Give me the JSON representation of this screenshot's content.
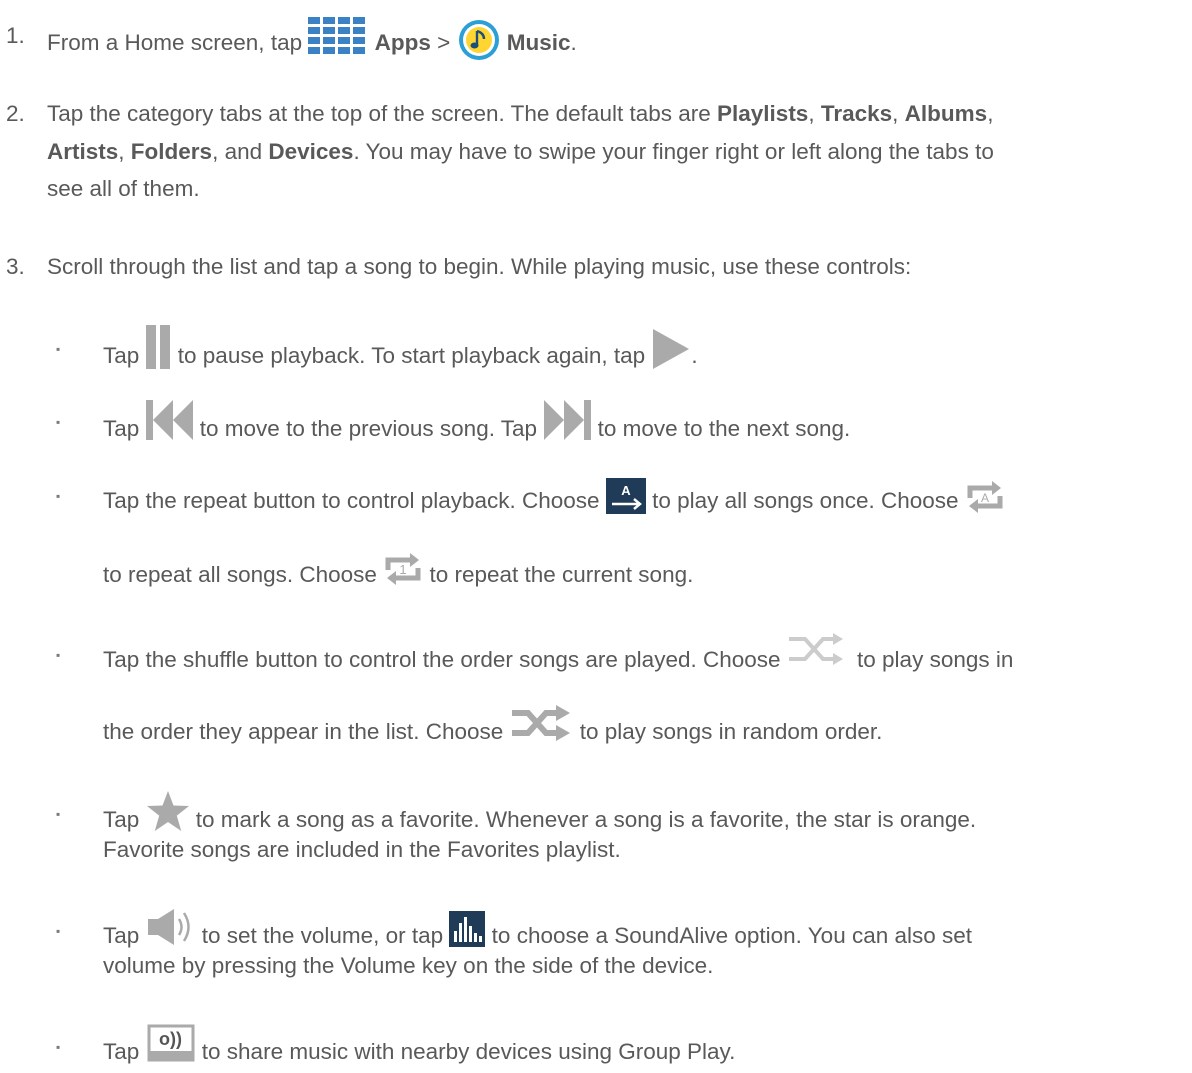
{
  "steps": [
    {
      "num": "1.",
      "prefix": "From a Home screen, tap ",
      "apps_label": "Apps",
      "sep": " > ",
      "music_label": "Music",
      "end": "."
    },
    {
      "num": "2.",
      "line1_a": "Tap the category tabs at the top of the screen. The default tabs are ",
      "playlists": "Playlists",
      "comma1": ", ",
      "tracks": "Tracks",
      "comma2": ", ",
      "albums": "Albums",
      "comma3": ",",
      "artists": "Artists",
      "comma4": ", ",
      "folders": "Folders",
      "and": ", and ",
      "devices": "Devices",
      "line2_end": ". You may have to swipe your finger right or left along the tabs to",
      "line3": "see all of them."
    },
    {
      "num": "3.",
      "text": "Scroll through the list and tap a song to begin. While playing music, use these controls:"
    }
  ],
  "bullets": [
    {
      "a": "Tap ",
      "b": " to pause playback. To start playback again, tap ",
      "c": "."
    },
    {
      "a": "Tap ",
      "b": " to move to the previous song. Tap ",
      "c": " to move to the next song."
    },
    {
      "a": "Tap the repeat button to control playback. Choose ",
      "b": " to play all songs once. Choose ",
      "c": "to repeat all songs. Choose ",
      "d": " to repeat the current song."
    },
    {
      "a": "Tap the shuffle button to control the order songs are played. Choose ",
      "b": " to play songs in",
      "c": "the order they appear in the list. Choose ",
      "d": " to play songs in random order."
    },
    {
      "a": "Tap ",
      "b": " to mark a song as a favorite. Whenever a song is a favorite, the star is orange.",
      "c": "Favorite songs are included in the Favorites playlist."
    },
    {
      "a": "Tap ",
      "b": " to set the volume, or tap ",
      "c": " to choose a SoundAlive option. You can also set",
      "d": "volume by pressing the Volume key on the side of the device."
    },
    {
      "a": "Tap ",
      "b": " to share music with nearby devices using Group Play."
    }
  ],
  "bullet_glyph": "▪",
  "icons": {
    "apps": "apps-grid-icon",
    "music": "music-note-icon",
    "pause": "pause-icon",
    "play": "play-icon",
    "previous": "previous-track-icon",
    "next": "next-track-icon",
    "repeat_off": "repeat-off-icon",
    "repeat_all": "repeat-all-icon",
    "repeat_one": "repeat-one-icon",
    "repeat_badge_letter": "A",
    "repeat_one_digit": "1",
    "shuffle_off": "shuffle-off-icon",
    "shuffle_on": "shuffle-on-icon",
    "favorite": "star-icon",
    "volume": "volume-icon",
    "soundalive": "soundalive-equalizer-icon",
    "group_play": "group-play-icon",
    "group_play_glyph": "o))"
  },
  "colors": {
    "text": "#595959",
    "icon_gray": "#aaaaaa",
    "apps_blue": "#3b82c4",
    "music_ring": "#2b9fd6",
    "music_inner": "#ffd531",
    "dark_icon": "#1f3b57"
  }
}
